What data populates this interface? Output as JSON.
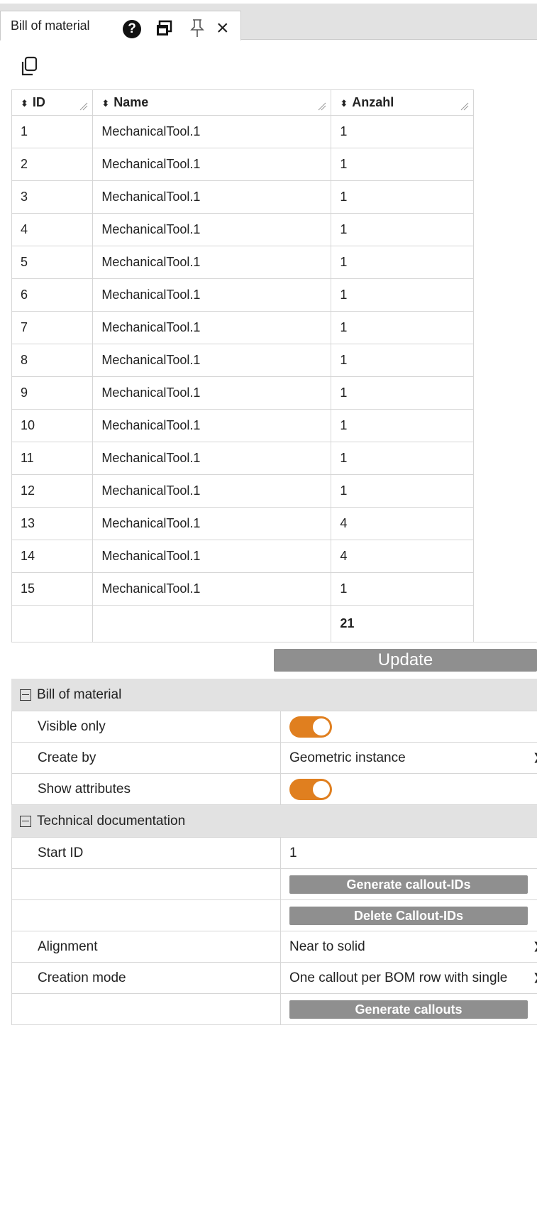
{
  "tab": {
    "title": "Bill of material",
    "help_glyph": "?",
    "close_glyph": "×"
  },
  "icons": [
    "help-icon",
    "restore-window-icon",
    "pin-icon",
    "close-icon",
    "copy-icon",
    "sort-icon",
    "resize-icon"
  ],
  "colors": {
    "accent": "#e07f1f",
    "total": "#d9822b",
    "button": "#8f8f8f",
    "section_bg": "#e2e2e2"
  },
  "table": {
    "columns": [
      {
        "label": "ID",
        "sort_glyph": "⬍"
      },
      {
        "label": "Name",
        "sort_glyph": "⬍"
      },
      {
        "label": "Anzahl",
        "sort_glyph": "⬍"
      }
    ],
    "rows": [
      {
        "id": "1",
        "name": "MechanicalTool.1",
        "qty": "1"
      },
      {
        "id": "2",
        "name": "MechanicalTool.1",
        "qty": "1"
      },
      {
        "id": "3",
        "name": "MechanicalTool.1",
        "qty": "1"
      },
      {
        "id": "4",
        "name": "MechanicalTool.1",
        "qty": "1"
      },
      {
        "id": "5",
        "name": "MechanicalTool.1",
        "qty": "1"
      },
      {
        "id": "6",
        "name": "MechanicalTool.1",
        "qty": "1"
      },
      {
        "id": "7",
        "name": "MechanicalTool.1",
        "qty": "1"
      },
      {
        "id": "8",
        "name": "MechanicalTool.1",
        "qty": "1"
      },
      {
        "id": "9",
        "name": "MechanicalTool.1",
        "qty": "1"
      },
      {
        "id": "10",
        "name": "MechanicalTool.1",
        "qty": "1"
      },
      {
        "id": "11",
        "name": "MechanicalTool.1",
        "qty": "1"
      },
      {
        "id": "12",
        "name": "MechanicalTool.1",
        "qty": "1"
      },
      {
        "id": "13",
        "name": "MechanicalTool.1",
        "qty": "4"
      },
      {
        "id": "14",
        "name": "MechanicalTool.1",
        "qty": "4"
      },
      {
        "id": "15",
        "name": "MechanicalTool.1",
        "qty": "1"
      }
    ],
    "total": "21"
  },
  "update_label": "Update",
  "bom_section": {
    "title": "Bill of material",
    "visible_only_label": "Visible only",
    "visible_only_value": true,
    "create_by_label": "Create by",
    "create_by_value": "Geometric instance",
    "show_attributes_label": "Show attributes",
    "show_attributes_value": true
  },
  "tech_section": {
    "title": "Technical documentation",
    "start_id_label": "Start ID",
    "start_id_value": "1",
    "generate_ids_label": "Generate callout-IDs",
    "delete_ids_label": "Delete Callout-IDs",
    "alignment_label": "Alignment",
    "alignment_value": "Near to solid",
    "creation_mode_label": "Creation mode",
    "creation_mode_value": "One callout per BOM row with single",
    "generate_callouts_label": "Generate callouts"
  }
}
